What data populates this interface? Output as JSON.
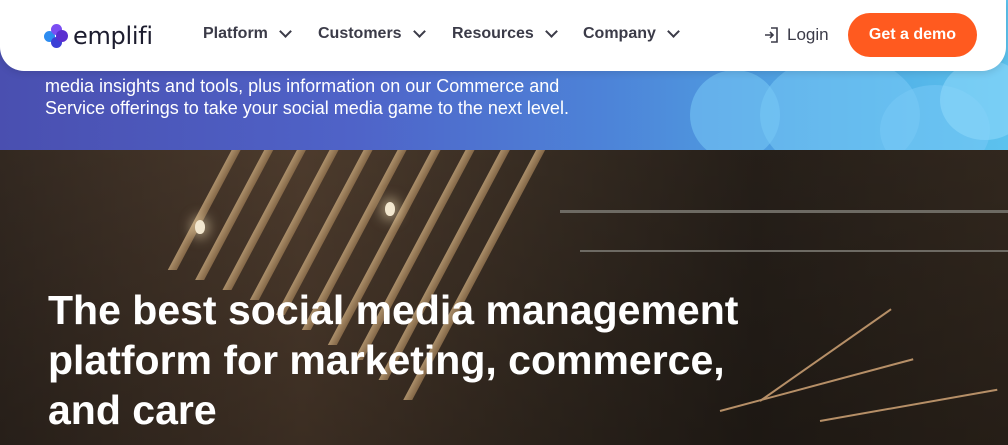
{
  "nav": {
    "brand": "emplifi",
    "items": [
      {
        "label": "Platform"
      },
      {
        "label": "Customers"
      },
      {
        "label": "Resources"
      },
      {
        "label": "Company"
      }
    ],
    "login_label": "Login",
    "cta_label": "Get a demo"
  },
  "banner": {
    "text": "media insights and tools, plus information on our Commerce and Service offerings to take your social media game to the next level."
  },
  "hero": {
    "title": "The best social media management platform for marketing, commerce, and care"
  },
  "colors": {
    "accent": "#ff5a1f",
    "nav_text": "#3b3b48",
    "banner_start": "#4a4fb0",
    "banner_end": "#5cc2ee"
  }
}
